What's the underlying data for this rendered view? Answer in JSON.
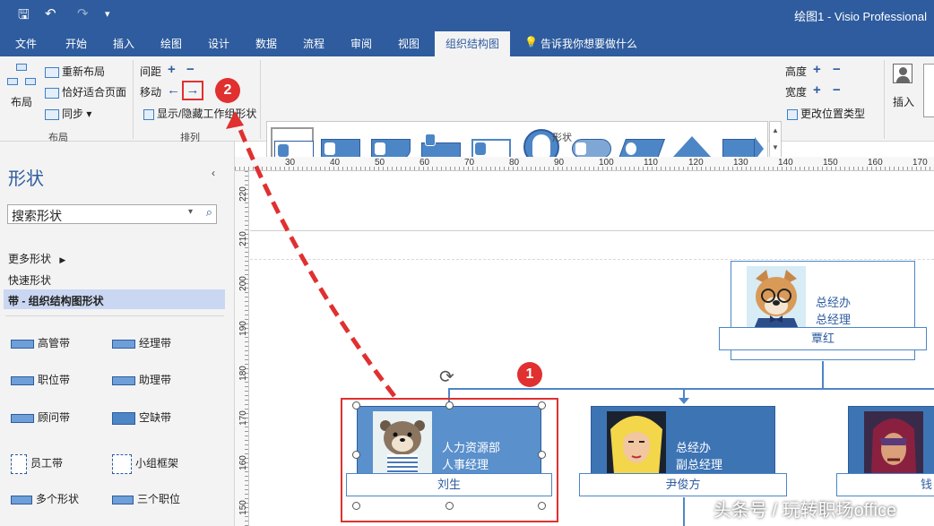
{
  "window": {
    "title": "绘图1 - Visio Professional"
  },
  "tabs": [
    "文件",
    "开始",
    "插入",
    "绘图",
    "设计",
    "数据",
    "流程",
    "审阅",
    "视图",
    "组织结构图"
  ],
  "tell_me": "告诉我你想要做什么",
  "ribbon": {
    "layout": {
      "label": "布局",
      "relayout": "重新布局",
      "fit_page": "恰好适合页面",
      "sync": "同步",
      "group": "布局"
    },
    "arrange": {
      "spacing": "间距",
      "move": "移动",
      "show_hide": "显示/隐藏工作组形状",
      "group": "排列"
    },
    "shapes": {
      "group": "形状",
      "height": "高度",
      "width": "宽度",
      "change_position_type": "更改位置类型"
    },
    "insert": {
      "label": "插入"
    }
  },
  "sidebar": {
    "title": "形状",
    "search_placeholder": "搜索形状",
    "more_shapes": "更多形状",
    "quick_shapes": "快速形状",
    "selected_stencil": "带 - 组织结构图形状",
    "shapes": [
      "高管带",
      "经理带",
      "职位带",
      "助理带",
      "顾问带",
      "空缺带",
      "员工带",
      "小组框架",
      "多个形状",
      "三个职位"
    ]
  },
  "ruler": {
    "h": [
      "30",
      "40",
      "50",
      "60",
      "70",
      "80",
      "90",
      "100",
      "110",
      "120",
      "130",
      "140",
      "150",
      "160",
      "170"
    ],
    "v": [
      "220",
      "210",
      "200",
      "190",
      "180",
      "170",
      "160",
      "150"
    ]
  },
  "org": {
    "ceo": {
      "dept": "总经办",
      "title": "总经理",
      "name": "覃红"
    },
    "hr": {
      "dept": "人力资源部",
      "title": "人事经理",
      "name": "刘生"
    },
    "vp": {
      "dept": "总经办",
      "title": "副总经理",
      "name": "尹俊方"
    },
    "right": {
      "name": "钱"
    }
  },
  "badges": {
    "one": "1",
    "two": "2"
  },
  "watermark": "头条号 / 玩转职场office",
  "colors": {
    "ribbon_blue": "#2e5c9e",
    "shape_blue": "#4d86c6",
    "highlight_red": "#e03030"
  }
}
